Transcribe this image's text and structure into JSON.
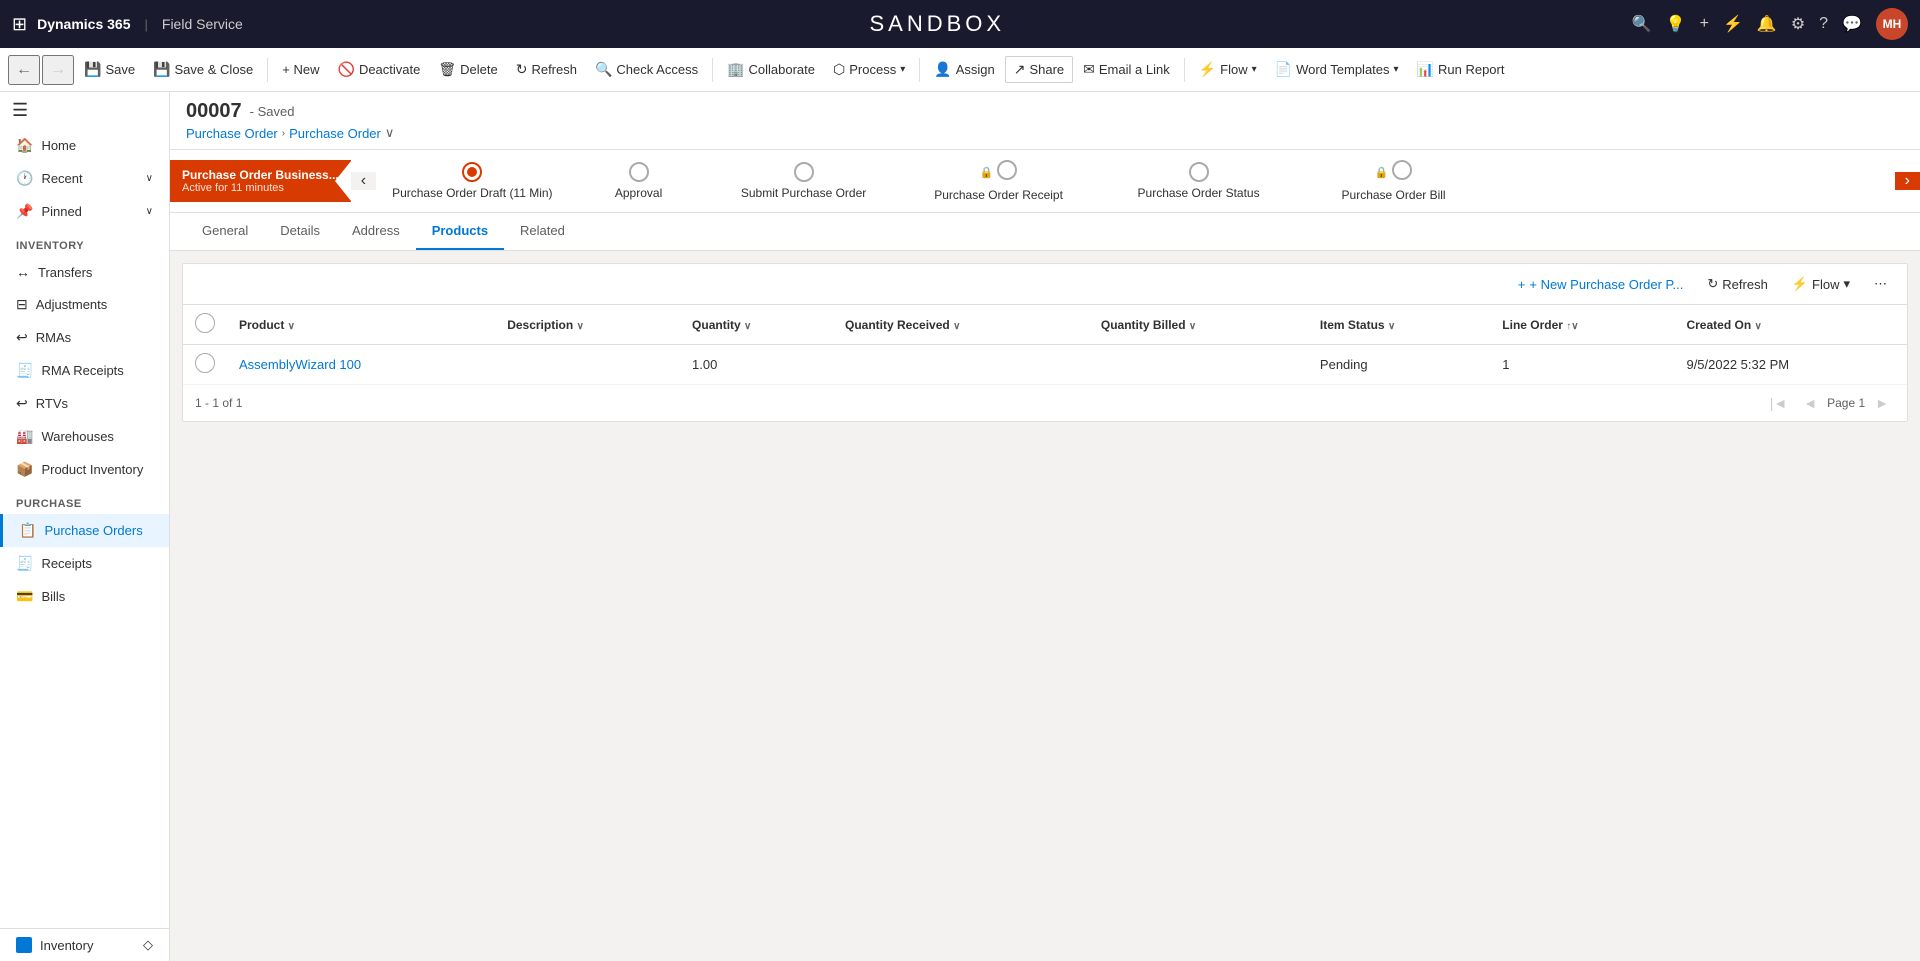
{
  "topNav": {
    "gridIcon": "⊞",
    "brand": "Dynamics 365",
    "separator": "|",
    "module": "Field Service",
    "sandboxTitle": "SANDBOX",
    "icons": [
      "🔍",
      "💡",
      "+",
      "⚙",
      "🔔",
      "⚙",
      "?",
      "💬"
    ],
    "avatar": "MH"
  },
  "toolbar": {
    "back": "←",
    "forward": "→",
    "save": "Save",
    "saveClose": "Save & Close",
    "new": "+ New",
    "deactivate": "Deactivate",
    "delete": "Delete",
    "refresh": "Refresh",
    "checkAccess": "Check Access",
    "collaborate": "Collaborate",
    "process": "Process",
    "assign": "Assign",
    "share": "Share",
    "emailLink": "Email a Link",
    "flow": "Flow",
    "wordTemplates": "Word Templates",
    "runReport": "Run Report"
  },
  "sidebar": {
    "hamburger": "☰",
    "home": "Home",
    "recent": "Recent",
    "pinned": "Pinned",
    "sections": {
      "inventory": {
        "label": "Inventory",
        "items": [
          "Transfers",
          "Adjustments",
          "RMAs",
          "RMA Receipts",
          "RTVs",
          "Warehouses",
          "Product Inventory"
        ]
      },
      "purchase": {
        "label": "Purchase",
        "items": [
          "Purchase Orders",
          "Receipts",
          "Bills"
        ]
      }
    },
    "bottomLabel": "Inventory"
  },
  "record": {
    "number": "00007",
    "savedStatus": "- Saved",
    "breadcrumb1": "Purchase Order",
    "breadcrumb2": "Purchase Order",
    "breadcrumbChevron": "∨"
  },
  "processSteps": [
    {
      "label": "Purchase Order Draft",
      "sublabel": "(11 Min)",
      "active": true,
      "current": true
    },
    {
      "label": "Approval",
      "sublabel": "",
      "active": false
    },
    {
      "label": "Submit Purchase Order",
      "sublabel": "",
      "active": false
    },
    {
      "label": "Purchase Order Receipt",
      "sublabel": "",
      "active": false,
      "locked": true
    },
    {
      "label": "Purchase Order Status",
      "sublabel": "",
      "active": false
    },
    {
      "label": "Purchase Order Bill",
      "sublabel": "",
      "active": false,
      "locked": true
    }
  ],
  "businessProcess": {
    "label": "Purchase Order Business...",
    "sublabel": "Active for 11 minutes"
  },
  "tabs": [
    {
      "label": "General",
      "active": false
    },
    {
      "label": "Details",
      "active": false
    },
    {
      "label": "Address",
      "active": false
    },
    {
      "label": "Products",
      "active": true
    },
    {
      "label": "Related",
      "active": false
    }
  ],
  "productsGrid": {
    "newButtonLabel": "+ New Purchase Order P...",
    "refreshLabel": "Refresh",
    "flowLabel": "Flow",
    "moreIcon": "⋯",
    "columns": [
      {
        "label": "Product",
        "sortable": true
      },
      {
        "label": "Description",
        "sortable": true
      },
      {
        "label": "Quantity",
        "sortable": true
      },
      {
        "label": "Quantity Received",
        "sortable": true
      },
      {
        "label": "Quantity Billed",
        "sortable": true
      },
      {
        "label": "Item Status",
        "sortable": true
      },
      {
        "label": "Line Order",
        "sortable": true,
        "sorted": "asc"
      },
      {
        "label": "Created On",
        "sortable": true
      }
    ],
    "rows": [
      {
        "product": "AssemblyWizard 100",
        "description": "",
        "quantity": "1.00",
        "quantityReceived": "",
        "quantityBilled": "",
        "itemStatus": "Pending",
        "lineOrder": "1",
        "createdOn": "9/5/2022 5:32 PM"
      }
    ],
    "pagination": {
      "range": "1 - 1 of 1",
      "pageLabel": "Page 1"
    }
  }
}
